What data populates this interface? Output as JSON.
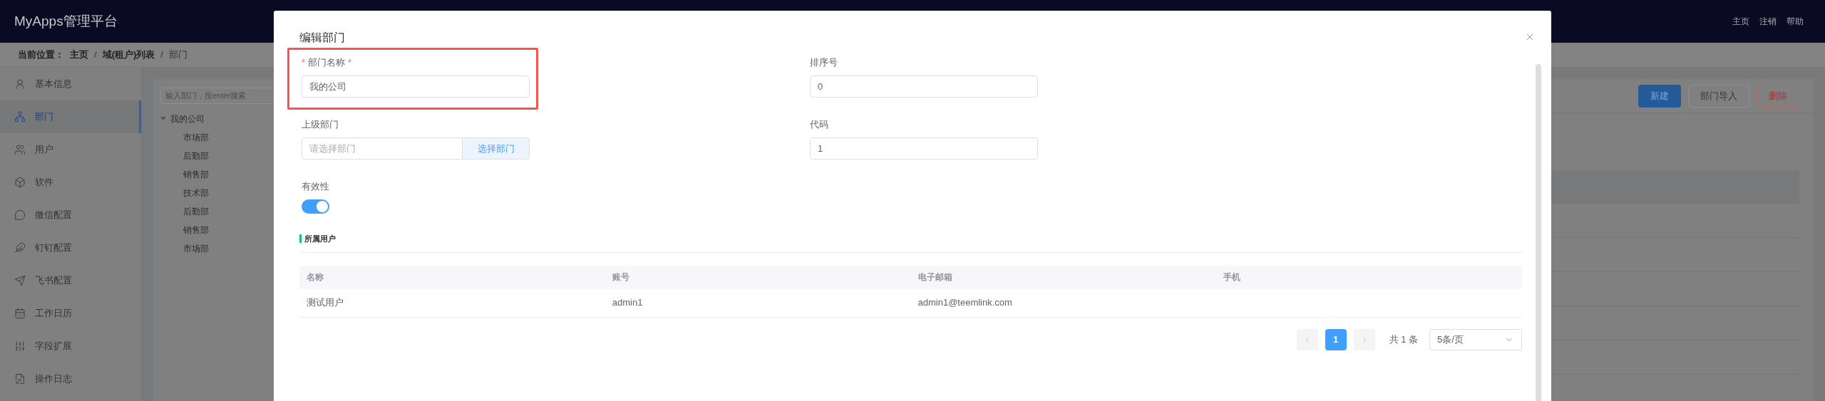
{
  "app": {
    "title": "MyApps管理平台",
    "nav": [
      "主页",
      "注销",
      "帮助"
    ]
  },
  "breadcrumb": {
    "label": "当前位置：",
    "separator": "/",
    "items": [
      "主页",
      "域(租户)列表",
      "部门"
    ]
  },
  "sidebar": {
    "items": [
      {
        "label": "基本信息",
        "selected": false
      },
      {
        "label": "部门",
        "selected": true
      },
      {
        "label": "用户",
        "selected": false
      },
      {
        "label": "软件",
        "selected": false
      },
      {
        "label": "微信配置",
        "selected": false
      },
      {
        "label": "钉钉配置",
        "selected": false
      },
      {
        "label": "飞书配置",
        "selected": false
      },
      {
        "label": "工作日历",
        "selected": false
      },
      {
        "label": "字段扩展",
        "selected": false
      },
      {
        "label": "操作日志",
        "selected": false
      }
    ]
  },
  "tree": {
    "search": {
      "placeholder": "输入部门，按enter搜索"
    },
    "items": [
      {
        "label": "我的公司",
        "expanded": true,
        "children": [
          {
            "label": "市场部"
          },
          {
            "label": "后勤部"
          },
          {
            "label": "销售部"
          },
          {
            "label": "技术部"
          },
          {
            "label": "后勤部"
          },
          {
            "label": "销售部"
          },
          {
            "label": "市场部"
          }
        ]
      }
    ]
  },
  "toolbar": {
    "buttons": [
      {
        "label": "新建",
        "kind": "primary"
      },
      {
        "label": "部门导入",
        "kind": "default"
      },
      {
        "label": "删除",
        "kind": "danger"
      }
    ]
  },
  "dialog": {
    "title": "编辑部门",
    "fields": [
      {
        "kind": "text",
        "prefix": "*",
        "label": "部门名称",
        "suffix": "*",
        "highlighted": true,
        "value": "我的公司"
      },
      {
        "kind": "text",
        "label": "排序号",
        "value": "0"
      },
      {
        "kind": "picker",
        "label": "上级部门",
        "placeholder": "请选择部门",
        "button": "选择部门"
      },
      {
        "kind": "text",
        "label": "代码",
        "value": "1"
      },
      {
        "kind": "switch",
        "label": "有效性",
        "on": true
      }
    ],
    "users": {
      "title": "所属用户",
      "columns": [
        "名称",
        "账号",
        "电子邮箱",
        "手机"
      ],
      "rows": [
        {
          "cells": [
            "测试用户",
            "admin1",
            "admin1@teemlink.com"
          ]
        }
      ],
      "pagination": {
        "pages": [
          {
            "label": "1",
            "selected": true
          }
        ],
        "total": "共 1 条",
        "page_size": "5条/页"
      }
    }
  }
}
